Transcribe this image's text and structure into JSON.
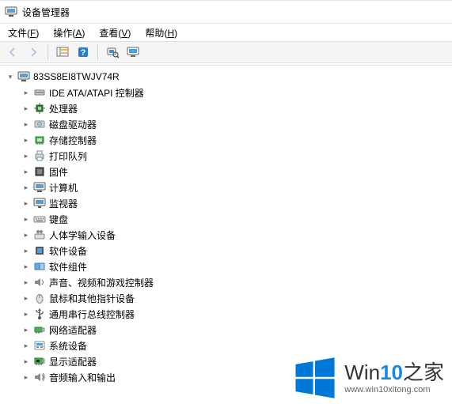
{
  "window": {
    "title": "设备管理器"
  },
  "menu": {
    "items": [
      {
        "label": "文件",
        "accel": "F"
      },
      {
        "label": "操作",
        "accel": "A"
      },
      {
        "label": "查看",
        "accel": "V"
      },
      {
        "label": "帮助",
        "accel": "H"
      }
    ]
  },
  "toolbar": {
    "back": "back-icon",
    "forward": "forward-icon",
    "show_hidden": "show-hidden-icon",
    "help": "help-icon",
    "scan": "scan-icon",
    "monitor": "monitor-icon"
  },
  "tree": {
    "root": {
      "label": "83SS8EI8TWJV74R",
      "icon": "computer-icon",
      "expanded": true
    },
    "categories": [
      {
        "label": "IDE ATA/ATAPI 控制器",
        "icon": "ide-controller-icon"
      },
      {
        "label": "处理器",
        "icon": "cpu-icon"
      },
      {
        "label": "磁盘驱动器",
        "icon": "disk-drive-icon"
      },
      {
        "label": "存储控制器",
        "icon": "storage-controller-icon"
      },
      {
        "label": "打印队列",
        "icon": "print-queue-icon"
      },
      {
        "label": "固件",
        "icon": "firmware-icon"
      },
      {
        "label": "计算机",
        "icon": "computer-class-icon"
      },
      {
        "label": "监视器",
        "icon": "monitor-class-icon"
      },
      {
        "label": "键盘",
        "icon": "keyboard-icon"
      },
      {
        "label": "人体学输入设备",
        "icon": "hid-icon"
      },
      {
        "label": "软件设备",
        "icon": "software-device-icon"
      },
      {
        "label": "软件组件",
        "icon": "software-component-icon"
      },
      {
        "label": "声音、视频和游戏控制器",
        "icon": "audio-icon"
      },
      {
        "label": "鼠标和其他指针设备",
        "icon": "mouse-icon"
      },
      {
        "label": "通用串行总线控制器",
        "icon": "usb-icon"
      },
      {
        "label": "网络适配器",
        "icon": "network-adapter-icon"
      },
      {
        "label": "系统设备",
        "icon": "system-device-icon"
      },
      {
        "label": "显示适配器",
        "icon": "display-adapter-icon"
      },
      {
        "label": "音频输入和输出",
        "icon": "audio-io-icon"
      }
    ]
  },
  "watermark": {
    "brand_prefix": "Win",
    "brand_highlight": "10",
    "brand_suffix": "之家",
    "url": "www.win10xitong.com"
  },
  "colors": {
    "win_blue": "#0078d7",
    "accent": "#1a89d8"
  }
}
